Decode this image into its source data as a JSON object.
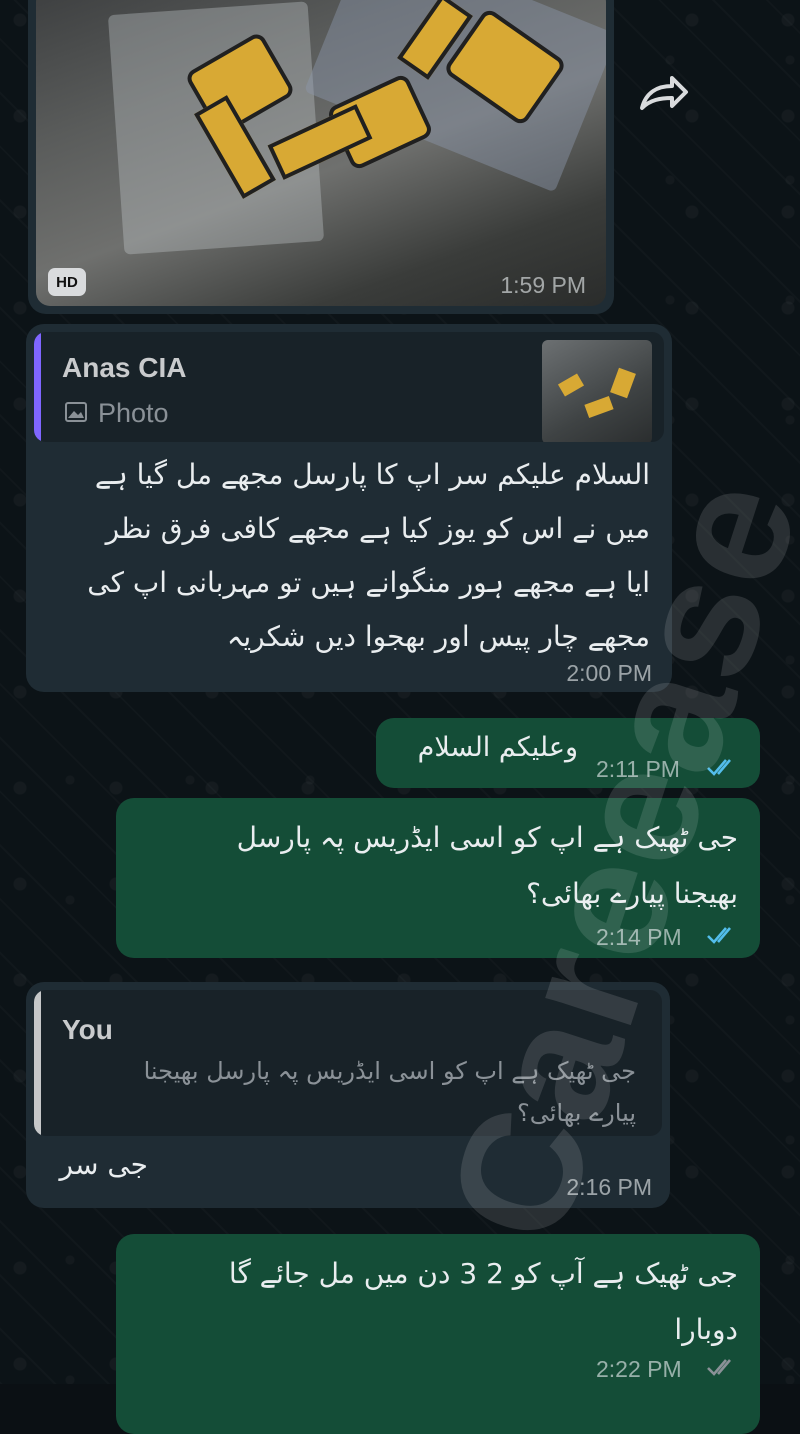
{
  "messages": {
    "image_message": {
      "badge": "HD",
      "time": "1:59 PM"
    },
    "incoming_reply_1": {
      "quote_author": "Anas CIA",
      "quote_type": "Photo",
      "text_lines": [
        "السلام علیکم سر اپ کا پارسل مجھے مل گیا ہے",
        "میں نے اس کو یوز کیا ہے مجھے کافی فرق نظر",
        "ایا ہے مجھے ہور منگوانے ہیں تو مہربانی اپ کی",
        "مجھے چار پیس اور بھجوا دیں شکریہ"
      ],
      "time": "2:00 PM"
    },
    "outgoing_1": {
      "text": "وعلیکم السلام",
      "time": "2:11 PM"
    },
    "outgoing_2": {
      "text_lines": [
        "جی ٹھیک ہے اپ کو اسی ایڈریس پہ پارسل",
        "بھیجنا پیارے بھائی؟"
      ],
      "time": "2:14 PM"
    },
    "incoming_reply_2": {
      "quote_author": "You",
      "quote_lines": [
        "جی ٹھیک ہے اپ کو اسی ایڈریس پہ پارسل بھیجنا",
        "پیارے بھائی؟"
      ],
      "text": "جی سر",
      "time": "2:16 PM"
    },
    "outgoing_3": {
      "text_lines": [
        "جی ٹھیک ہے آپ کو 2 3 دن میں مل جائے گا",
        "دوبارا"
      ],
      "time": "2:22 PM"
    }
  },
  "watermark": "Careease",
  "colors": {
    "incoming_bubble": "#1f2c34",
    "outgoing_bubble": "#144d37",
    "read_ticks": "#53bdeb",
    "quote_bar_contact": "#7f66ff",
    "quote_bar_self": "#c6c8c9"
  },
  "icons": [
    "forward-icon",
    "image-icon",
    "double-check-icon"
  ]
}
